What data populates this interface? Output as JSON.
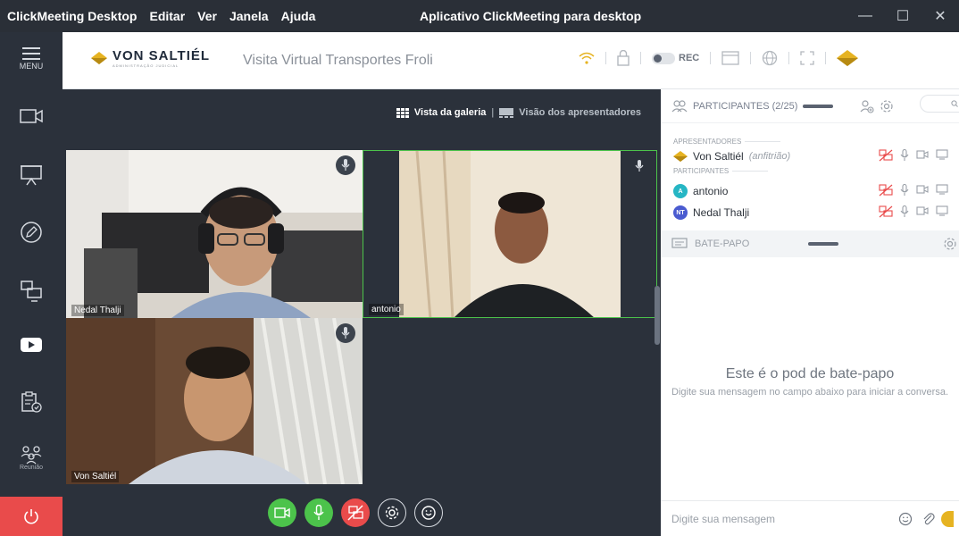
{
  "titlebar": {
    "menus": [
      "ClickMeeting Desktop",
      "Editar",
      "Ver",
      "Janela",
      "Ajuda"
    ],
    "window_title": "Aplicativo ClickMeeting para desktop"
  },
  "rail": {
    "menu_label": "MENU",
    "meeting_label": "Reunião"
  },
  "header": {
    "logo_name": "VON SALTIÉL",
    "logo_sub": "ADMINISTRAÇÃO JUDICIAL",
    "meeting_title": "Visita Virtual Transportes Froli",
    "rec_label": "REC"
  },
  "view": {
    "gallery_label": "Vista da galeria",
    "presenters_label": "Visão dos apresentadores"
  },
  "tiles": [
    {
      "name": "Nedal Thalji"
    },
    {
      "name": "antonio"
    },
    {
      "name": "Von Saltiél"
    }
  ],
  "panel": {
    "participants_title": "PARTICIPANTES (2/25)",
    "presenters_section": "APRESENTADORES",
    "participants_section": "PARTICIPANTES",
    "host": {
      "name": "Von Saltiél",
      "role": "(anfitrião)"
    },
    "participants": [
      {
        "name": "antonio",
        "initials": "A",
        "color": "#26b6c4"
      },
      {
        "name": "Nedal Thalji",
        "initials": "NT",
        "color": "#4a5bd0"
      }
    ],
    "chat_title": "BATE-PAPO",
    "chat_empty_title": "Este é o pod de bate-papo",
    "chat_empty_text": "Digite sua mensagem no campo abaixo para iniciar a conversa.",
    "chat_placeholder": "Digite sua mensagem"
  },
  "colors": {
    "accent_green": "#4cc34b",
    "danger_red": "#e94b4b",
    "brand_gold": "#e6b322"
  }
}
